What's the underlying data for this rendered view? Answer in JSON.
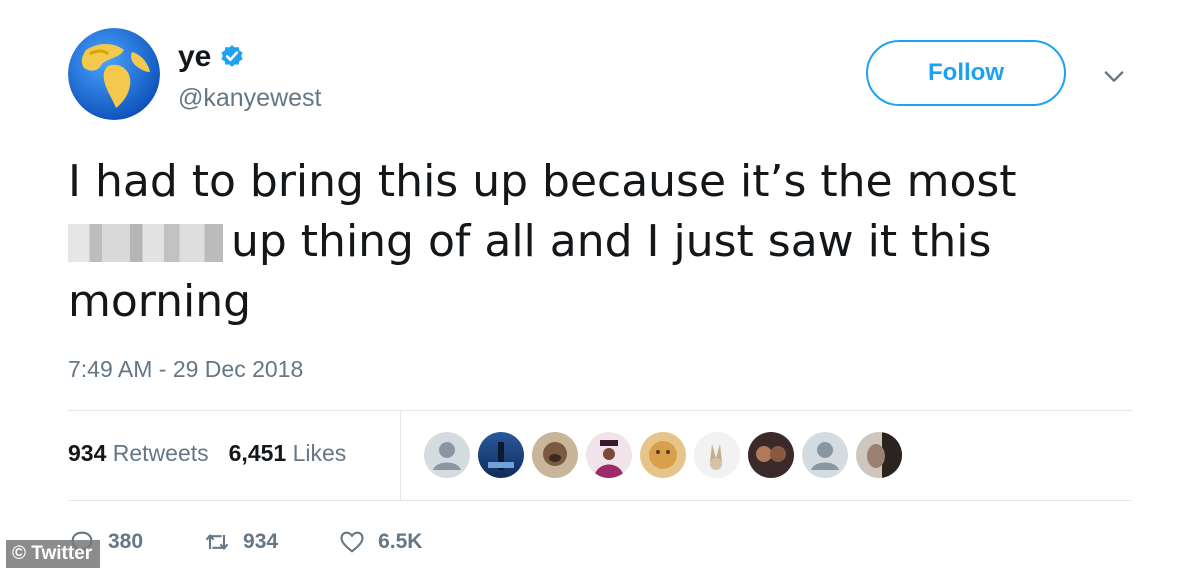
{
  "user": {
    "display_name": "ye",
    "handle": "@kanyewest",
    "avatar_icon": "earth-globe-icon",
    "verified_icon": "verified-badge-icon"
  },
  "follow_label": "Follow",
  "tweet": {
    "lines": [
      "I had to bring this up because it’s the most",
      "up thing of all and I just saw it this",
      "morning"
    ],
    "timestamp": "7:49 AM - 29 Dec 2018"
  },
  "stats": {
    "retweets_count": "934",
    "retweets_label": "Retweets",
    "likes_count": "6,451",
    "likes_label": "Likes"
  },
  "actions": {
    "reply_count": "380",
    "retweet_count": "934",
    "like_count": "6.5K"
  },
  "watermark": "© Twitter",
  "colors": {
    "accent": "#1da1f2",
    "text": "#14171a",
    "secondary": "#657786",
    "divider": "#e1e8ed"
  }
}
